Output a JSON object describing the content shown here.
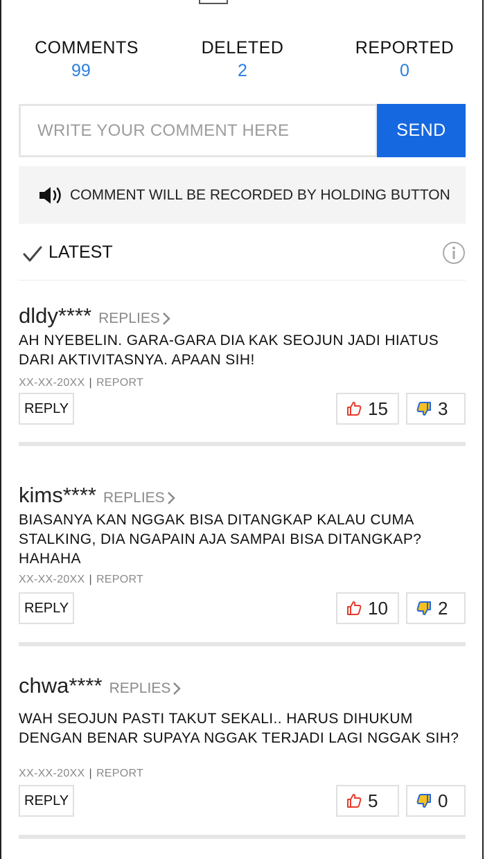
{
  "stats": {
    "comments_label": "COMMENTS",
    "comments_count": "99",
    "deleted_label": "DELETED",
    "deleted_count": "2",
    "reported_label": "REPORTED",
    "reported_count": "0"
  },
  "compose": {
    "placeholder": "WRITE YOUR COMMENT HERE",
    "send_label": "SEND"
  },
  "voice": {
    "text": "COMMENT WILL BE RECORDED BY HOLDING BUTTON",
    "icon": "speaker-icon"
  },
  "sort": {
    "label": "LATEST",
    "check_icon": "check-icon",
    "info_icon": "info-icon"
  },
  "colors": {
    "accent": "#1668e0",
    "count": "#2a7fe0",
    "like": "#e53b2c",
    "dislike": "#2767d8"
  },
  "comments": [
    {
      "user": "dldy****",
      "replies_label": "REPLIES",
      "text": "AH NYEBELIN. GARA-GARA DIA KAK SEOJUN JADI HIATUS DARI AKTIVITASNYA. APAAN SIH!",
      "date": "XX-XX-20XX",
      "report_label": "REPORT",
      "reply_label": "REPLY",
      "likes": "15",
      "dislikes": "3"
    },
    {
      "user": "kims****",
      "replies_label": "REPLIES",
      "text": "BIASANYA KAN NGGAK BISA DITANGKAP KALAU CUMA STALKING, DIA NGAPAIN AJA SAMPAI BISA DITANGKAP? HAHAHA",
      "date": "XX-XX-20XX",
      "report_label": "REPORT",
      "reply_label": "REPLY",
      "likes": "10",
      "dislikes": "2"
    },
    {
      "user": "chwa****",
      "replies_label": "REPLIES",
      "text": "WAH SEOJUN PASTI TAKUT SEKALI.. HARUS DIHUKUM DENGAN BENAR SUPAYA NGGAK TERJADI LAGI NGGAK SIH?",
      "date": "XX-XX-20XX",
      "report_label": "REPORT",
      "reply_label": "REPLY",
      "likes": "5",
      "dislikes": "0"
    }
  ]
}
